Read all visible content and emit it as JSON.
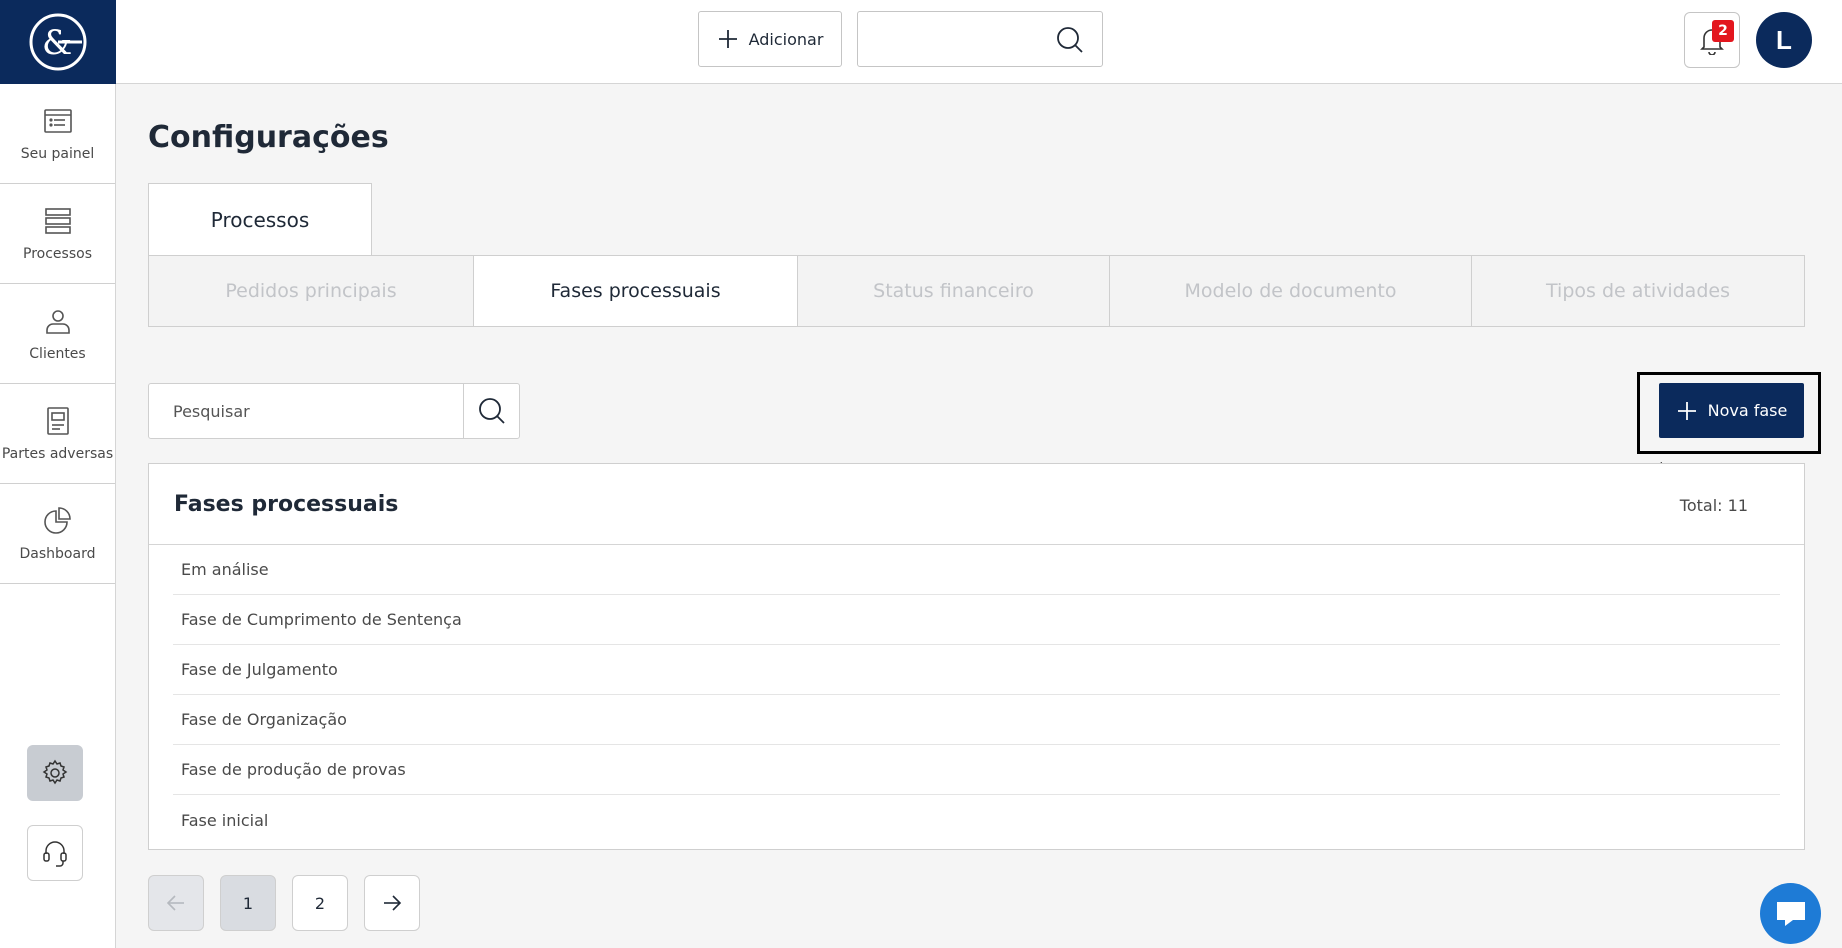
{
  "sidebar": {
    "items": [
      {
        "label": "Seu painel",
        "icon": "dashboard-list-icon"
      },
      {
        "label": "Processos",
        "icon": "stack-icon"
      },
      {
        "label": "Clientes",
        "icon": "user-icon"
      },
      {
        "label": "Partes adversas",
        "icon": "document-icon"
      },
      {
        "label": "Dashboard",
        "icon": "pie-chart-icon"
      }
    ]
  },
  "topbar": {
    "add_label": "Adicionar",
    "notifications_count": "2",
    "avatar_initial": "L"
  },
  "page": {
    "title": "Configurações",
    "main_tab": "Processos",
    "subtabs": [
      {
        "label": "Pedidos principais",
        "active": false
      },
      {
        "label": "Fases processuais",
        "active": true
      },
      {
        "label": "Status financeiro",
        "active": false
      },
      {
        "label": "Modelo de documento",
        "active": false
      },
      {
        "label": "Tipos de atividades",
        "active": false
      }
    ],
    "search_placeholder": "Pesquisar",
    "new_button_label": "Nova fase"
  },
  "list": {
    "title": "Fases processuais",
    "total": "Total: 11",
    "rows": [
      "Em análise",
      "Fase de Cumprimento de Sentença",
      "Fase de Julgamento",
      "Fase de Organização",
      "Fase de produção de provas",
      "Fase inicial"
    ]
  },
  "pagination": {
    "pages": [
      "1",
      "2"
    ],
    "current": "1"
  },
  "colors": {
    "brand": "#0b2a5c",
    "badge": "#e3161e",
    "chat": "#1e7bd6"
  }
}
